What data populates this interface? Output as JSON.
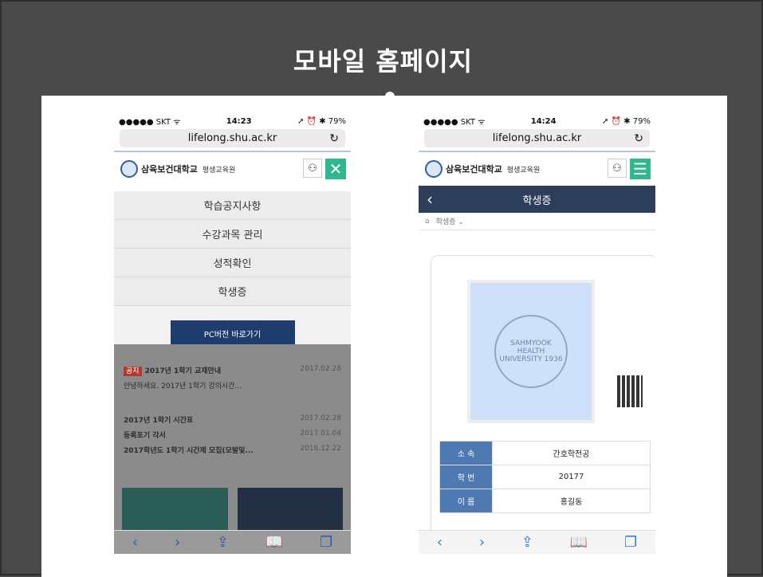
{
  "slide": {
    "title": "모바일 홈페이지"
  },
  "phone1": {
    "status": {
      "carrier": "●●●●● SKT ᯤ",
      "time": "14:23",
      "right": "➚ ⏰ ✱ 79%"
    },
    "url": "lifelong.shu.ac.kr",
    "logo": {
      "name": "삼육보건대학교",
      "sub": "평생교육원"
    },
    "menu": [
      "학습공지사항",
      "수강과목 관리",
      "성적확인",
      "학생증"
    ],
    "pc_button": "PC버전 바로가기",
    "notice": [
      {
        "tag": "공지",
        "title": "2017년 1학기 교재안내",
        "date": "2017.02.28"
      },
      {
        "title": "안녕하세요. 2017년 1학기 강의시간...",
        "date": ""
      },
      {
        "title": "2017년 1학기 시간표",
        "date": "2017.02.28"
      },
      {
        "title": "등록포기 각서",
        "date": "2017.01.04"
      },
      {
        "title": "2017학년도 1학기 시간제 모집(모발및...",
        "date": "2016.12.22"
      }
    ]
  },
  "phone2": {
    "status": {
      "carrier": "●●●●● SKT ᯤ",
      "time": "14:24",
      "right": "➚ ⏰ ✱ 79%"
    },
    "url": "lifelong.shu.ac.kr",
    "logo": {
      "name": "삼육보건대학교",
      "sub": "평생교육원"
    },
    "nav_title": "학생증",
    "breadcrumb": "학생증 ⌄",
    "seal_text": "SAHMYOOK HEALTH UNIVERSITY 1936",
    "info": [
      {
        "label": "소 속",
        "value": "간호학전공"
      },
      {
        "label": "학 번",
        "value": "20177"
      },
      {
        "label": "이 름",
        "value": "홍길동"
      }
    ]
  },
  "icons": {
    "back": "‹",
    "forward": "›",
    "share": "⇪",
    "book": "📖",
    "tabs": "❐",
    "reload": "↻",
    "home": "⌂",
    "user": "⚇",
    "close": "✕",
    "menu": "☰"
  },
  "colors": {
    "accent": "#2fb78f",
    "navbar": "#2c3e59",
    "label": "#4e79b3"
  }
}
